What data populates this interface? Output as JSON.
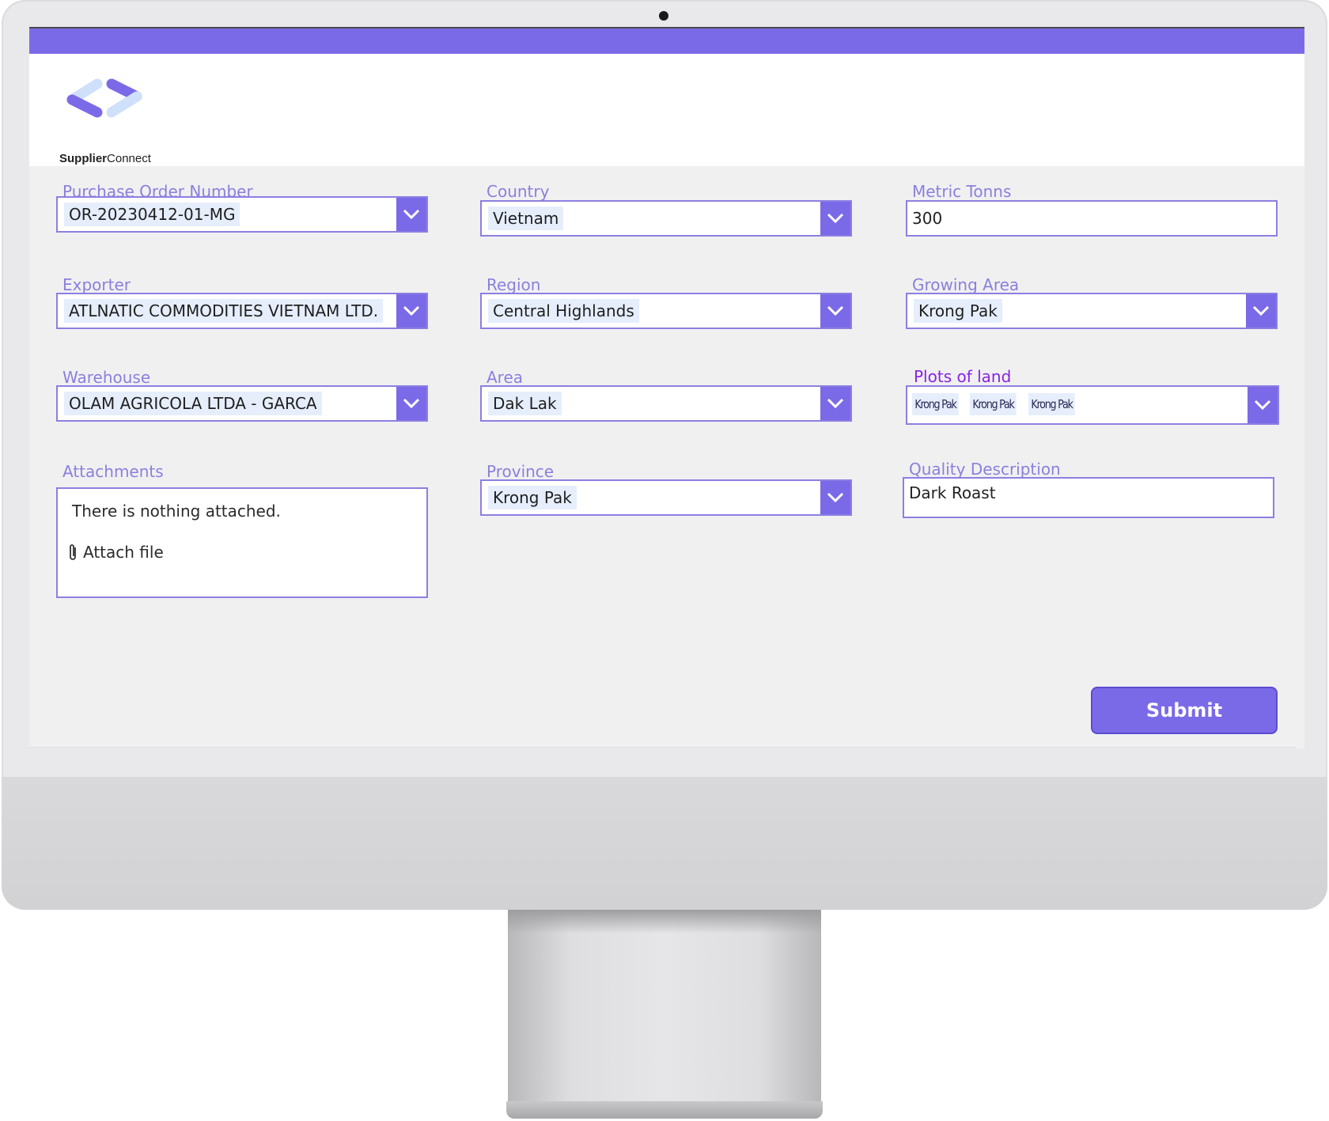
{
  "app": {
    "brand_bold": "Supplier",
    "brand_light": "Connect",
    "accent_color": "#7b6ae8",
    "label_color": "#8a80dc"
  },
  "form": {
    "purchase_order": {
      "label": "Purchase Order Number",
      "value": "OR-20230412-01-MG"
    },
    "country": {
      "label": "Country",
      "value": "Vietnam"
    },
    "metric_tonns": {
      "label": "Metric Tonns",
      "value": "300"
    },
    "exporter": {
      "label": "Exporter",
      "value": "ATLNATIC COMMODITIES VIETNAM LTD."
    },
    "region": {
      "label": "Region",
      "value": "Central Highlands"
    },
    "growing_area": {
      "label": "Growing Area",
      "value": "Krong Pak"
    },
    "warehouse": {
      "label": "Warehouse",
      "value": "OLAM AGRICOLA LTDA - GARCA"
    },
    "area": {
      "label": "Area",
      "value": "Dak Lak"
    },
    "plots": {
      "label": "Plots of land",
      "values": [
        "Krong Pak",
        "Krong Pak",
        "Krong Pak"
      ]
    },
    "attachments": {
      "label": "Attachments",
      "empty_text": "There is nothing attached.",
      "attach_label": "Attach file"
    },
    "province": {
      "label": "Province",
      "value": "Krong Pak"
    },
    "quality": {
      "label": "Quality Description",
      "value": "Dark Roast"
    },
    "submit_label": "Submit"
  },
  "icons": {
    "dropdown": "chevron-down-icon",
    "attach": "paperclip-icon",
    "logo": "code-brackets-logo"
  }
}
